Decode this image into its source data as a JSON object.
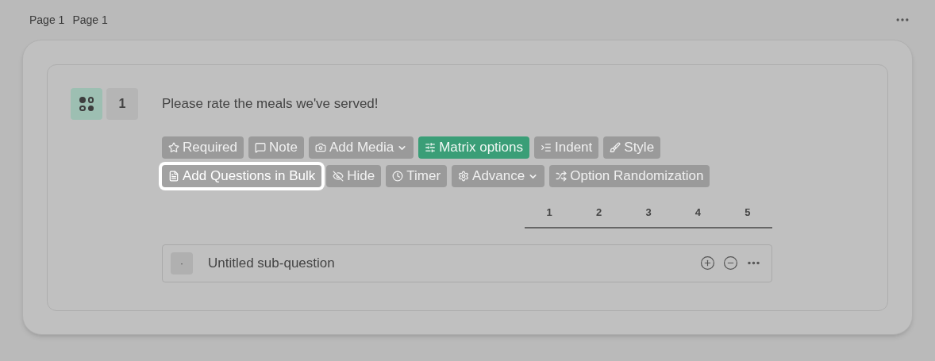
{
  "breadcrumb": [
    "Page 1",
    "Page 1"
  ],
  "question": {
    "number": "1",
    "title": "Please rate the meals we've served!"
  },
  "toolbar_rows": [
    [
      {
        "label": "Required",
        "selected": false,
        "highlighted": false,
        "dropdown": false
      },
      {
        "label": "Note",
        "selected": false,
        "highlighted": false,
        "dropdown": false
      },
      {
        "label": "Add Media",
        "selected": false,
        "highlighted": false,
        "dropdown": true
      },
      {
        "label": "Matrix options",
        "selected": true,
        "highlighted": false,
        "dropdown": false
      },
      {
        "label": "Indent",
        "selected": false,
        "highlighted": false,
        "dropdown": false
      },
      {
        "label": "Style",
        "selected": false,
        "highlighted": false,
        "dropdown": false
      }
    ],
    [
      {
        "label": "Add Questions in Bulk",
        "selected": false,
        "highlighted": true,
        "dropdown": false
      },
      {
        "label": "Hide",
        "selected": false,
        "highlighted": false,
        "dropdown": false
      },
      {
        "label": "Timer",
        "selected": false,
        "highlighted": false,
        "dropdown": false
      },
      {
        "label": "Advance",
        "selected": false,
        "highlighted": false,
        "dropdown": true
      },
      {
        "label": "Option Randomization",
        "selected": false,
        "highlighted": false,
        "dropdown": false
      }
    ]
  ],
  "scale": [
    "1",
    "2",
    "3",
    "4",
    "5"
  ],
  "sub_questions": [
    {
      "marker": "·",
      "text": "Untitled sub-question"
    }
  ]
}
